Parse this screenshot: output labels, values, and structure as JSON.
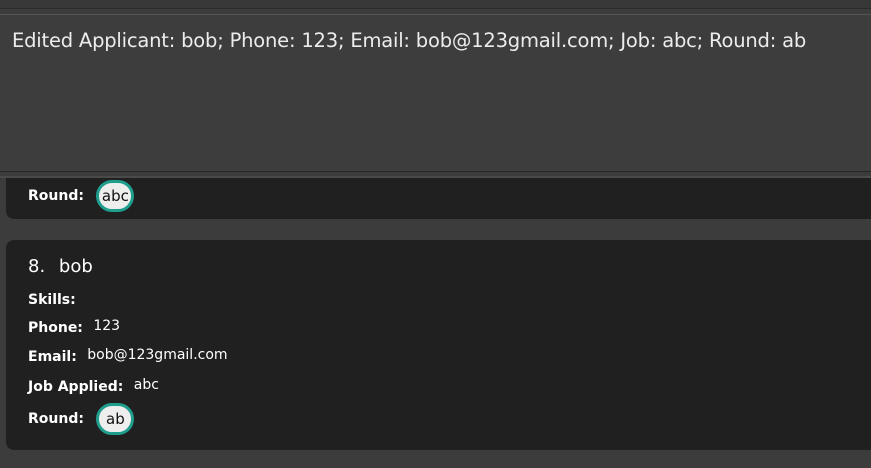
{
  "result_display": {
    "message": "Edited Applicant: bob; Phone: 123; Email: bob@123gmail.com; Job: abc; Round: ab"
  },
  "previous_card": {
    "round_label": "Round:",
    "round_tag": "abc"
  },
  "current_card": {
    "index": "8.",
    "name": "bob",
    "skills_label": "Skills:",
    "phone_label": "Phone:",
    "phone": "123",
    "email_label": "Email:",
    "email": "bob@123gmail.com",
    "job_label": "Job Applied:",
    "job": "abc",
    "round_label": "Round:",
    "round_tag": "ab"
  },
  "colors": {
    "background": "#3c3c3c",
    "card_background": "#202020",
    "tag_border": "#1f9e8e",
    "tag_background": "#eeeeee"
  }
}
